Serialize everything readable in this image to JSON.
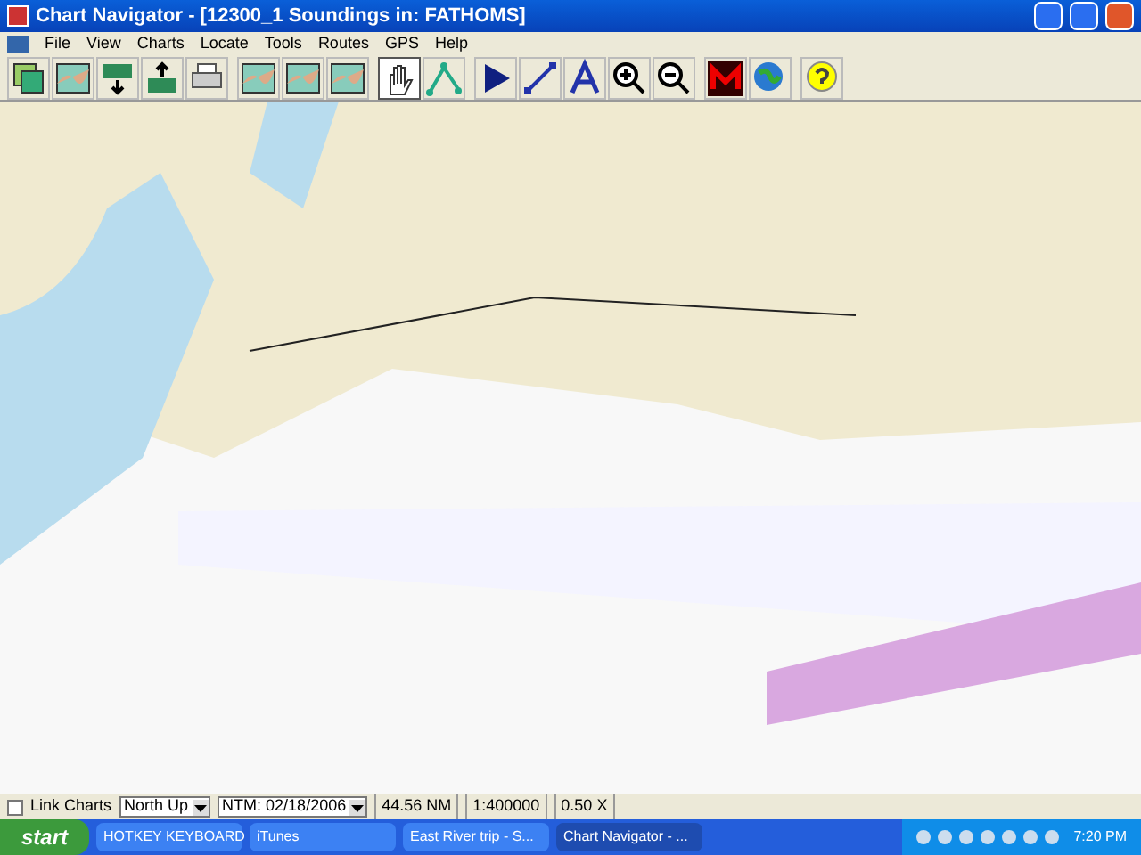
{
  "window": {
    "title": "Chart Navigator - [12300_1 Soundings in: FATHOMS]"
  },
  "menu": [
    "File",
    "View",
    "Charts",
    "Locate",
    "Tools",
    "Routes",
    "GPS",
    "Help"
  ],
  "toolbar": [
    {
      "kind": "layers",
      "selected": false
    },
    {
      "kind": "chart",
      "selected": false
    },
    {
      "kind": "scale-in",
      "selected": false
    },
    {
      "kind": "scale-out",
      "selected": false
    },
    {
      "kind": "print",
      "selected": false
    },
    {
      "kind": "chart",
      "selected": false
    },
    {
      "kind": "chart",
      "selected": false
    },
    {
      "kind": "chart",
      "selected": false
    },
    {
      "kind": "hand",
      "selected": true
    },
    {
      "kind": "route",
      "selected": false
    },
    {
      "kind": "flag",
      "selected": false
    },
    {
      "kind": "line",
      "selected": false
    },
    {
      "kind": "text",
      "selected": false
    },
    {
      "kind": "zoom-in",
      "selected": false
    },
    {
      "kind": "zoom-out",
      "selected": false
    },
    {
      "kind": "logo",
      "selected": false
    },
    {
      "kind": "globe",
      "selected": false
    },
    {
      "kind": "help",
      "selected": false
    }
  ],
  "status_bar": {
    "link_charts": {
      "label": "Link Charts",
      "checked": false
    },
    "orientation": "North Up",
    "ntm": "NTM: 02/18/2006",
    "distance": "44.56 NM",
    "scale": "1:400000",
    "zoom": "0.50 X"
  },
  "taskbar": {
    "start": "start",
    "tasks": [
      {
        "label": "HOTKEY KEYBOARD",
        "selected": false
      },
      {
        "label": "iTunes",
        "selected": false
      },
      {
        "label": "East River trip - S...",
        "selected": false
      },
      {
        "label": "Chart Navigator - ...",
        "selected": true
      }
    ],
    "clock": "7:20 PM"
  }
}
